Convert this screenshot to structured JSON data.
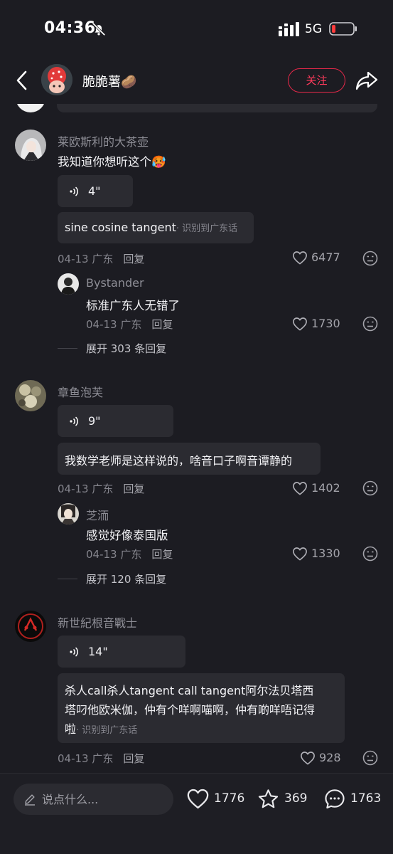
{
  "status_bar": {
    "time": "04:36",
    "network": "5G"
  },
  "header": {
    "user_name": "脆脆薯🥔",
    "follow_label": "关注"
  },
  "comments": [
    {
      "user": "莱欧斯利的大茶壶",
      "text": "我知道你想听这个🥵",
      "voice_duration": "4\"",
      "transcript": "sine cosine tangent",
      "transcript_note": "· 识别到广东话",
      "date_location": "04-13 广东",
      "reply_label": "回复",
      "likes": "6477",
      "reply": {
        "user": "Bystander",
        "text": "标准广东人无错了",
        "date_location": "04-13 广东",
        "reply_label": "回复",
        "likes": "1730"
      },
      "expand_label": "展开 303 条回复"
    },
    {
      "user": "章鱼泡芙",
      "voice_duration": "9\"",
      "transcript": "我数学老师是这样说的，啥音口子啊音谭静的",
      "date_location": "04-13 广东",
      "reply_label": "回复",
      "likes": "1402",
      "reply": {
        "user": "芝洏",
        "text": "感觉好像泰国版",
        "date_location": "04-13 广东",
        "reply_label": "回复",
        "likes": "1330"
      },
      "expand_label": "展开 120 条回复"
    },
    {
      "user": "新世紀根音戰士",
      "voice_duration": "14\"",
      "transcript_line1": "杀人call杀人tangent call tangent阿尔法贝塔西",
      "transcript_line2": "塔叼他欧米伽，仲有个咩啊喵啊，仲有啲咩唔记得",
      "transcript_line3": "啦",
      "transcript_note": "· 识别到广东话",
      "date_location": "04-13 广东",
      "reply_label": "回复",
      "likes": "928"
    }
  ],
  "bottom_bar": {
    "input_placeholder": "说点什么...",
    "likes": "1776",
    "favorites": "369",
    "comments": "1763"
  },
  "colors": {
    "accent": "#ff3b5c",
    "background": "#1c1c22",
    "card": "#2b2b31"
  }
}
